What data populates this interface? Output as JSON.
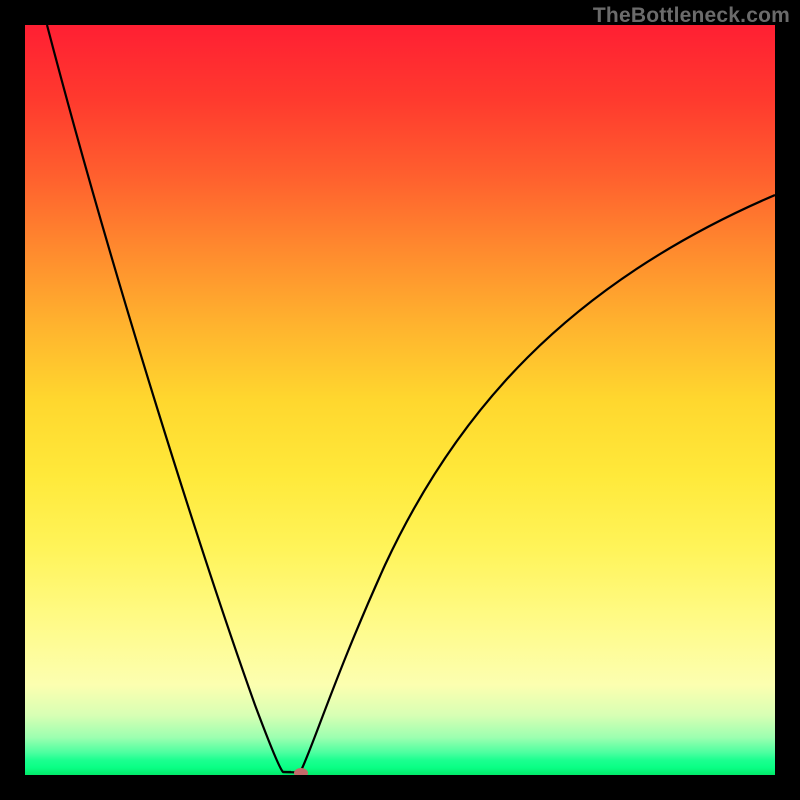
{
  "watermark": "TheBottleneck.com",
  "chart_data": {
    "type": "line",
    "title": "",
    "xlabel": "",
    "ylabel": "",
    "xlim": [
      0,
      100
    ],
    "ylim": [
      0,
      100
    ],
    "grid": false,
    "series": [
      {
        "name": "curve",
        "x": [
          3,
          10,
          20,
          30,
          34,
          36,
          37,
          40,
          48,
          60,
          80,
          100
        ],
        "y": [
          100,
          72,
          40,
          15,
          2,
          0,
          0,
          7,
          28,
          50,
          68,
          77
        ]
      }
    ],
    "markers": [
      {
        "name": "min-point",
        "x": 37,
        "y": 0
      }
    ],
    "background_gradient": {
      "axis": "y",
      "stops": [
        {
          "y": 100,
          "color": "#ff1f33"
        },
        {
          "y": 50,
          "color": "#ffd72e"
        },
        {
          "y": 10,
          "color": "#fcffb0"
        },
        {
          "y": 0,
          "color": "#02e869"
        }
      ]
    }
  }
}
